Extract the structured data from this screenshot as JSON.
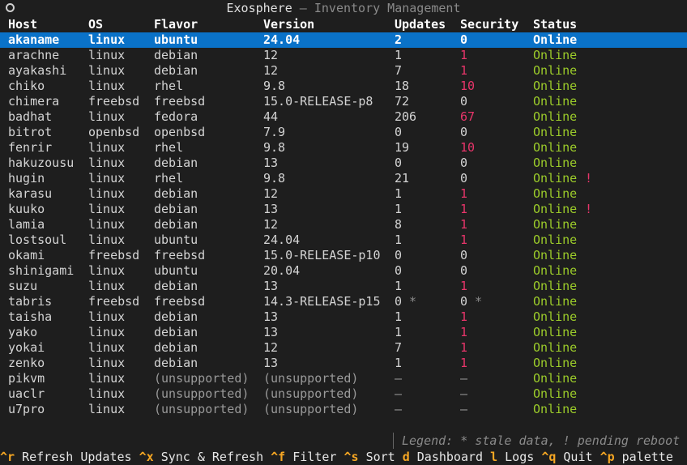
{
  "window": {
    "title": "Exosphere",
    "separator": " — ",
    "subtitle": "Inventory Management"
  },
  "columns": {
    "host": "Host",
    "os": "OS",
    "flavor": "Flavor",
    "version": "Version",
    "updates": "Updates",
    "security": "Security",
    "status": "Status"
  },
  "rows": [
    {
      "host": "akaname",
      "os": "linux",
      "flavor": "ubuntu",
      "version": "24.04",
      "updates": "2",
      "security": "0",
      "status": "Online",
      "selected": true
    },
    {
      "host": "arachne",
      "os": "linux",
      "flavor": "debian",
      "version": "12",
      "updates": "1",
      "security": "1",
      "status": "Online"
    },
    {
      "host": "ayakashi",
      "os": "linux",
      "flavor": "debian",
      "version": "12",
      "updates": "7",
      "security": "1",
      "status": "Online"
    },
    {
      "host": "chiko",
      "os": "linux",
      "flavor": "rhel",
      "version": "9.8",
      "updates": "18",
      "security": "10",
      "status": "Online"
    },
    {
      "host": "chimera",
      "os": "freebsd",
      "flavor": "freebsd",
      "version": "15.0-RELEASE-p8",
      "updates": "72",
      "security": "0",
      "status": "Online"
    },
    {
      "host": "badhat",
      "os": "linux",
      "flavor": "fedora",
      "version": "44",
      "updates": "206",
      "security": "67",
      "status": "Online"
    },
    {
      "host": "bitrot",
      "os": "openbsd",
      "flavor": "openbsd",
      "version": "7.9",
      "updates": "0",
      "security": "0",
      "status": "Online"
    },
    {
      "host": "fenrir",
      "os": "linux",
      "flavor": "rhel",
      "version": "9.8",
      "updates": "19",
      "security": "10",
      "status": "Online"
    },
    {
      "host": "hakuzousu",
      "os": "linux",
      "flavor": "debian",
      "version": "13",
      "updates": "0",
      "security": "0",
      "status": "Online"
    },
    {
      "host": "hugin",
      "os": "linux",
      "flavor": "rhel",
      "version": "9.8",
      "updates": "21",
      "security": "0",
      "status": "Online",
      "flag": "!"
    },
    {
      "host": "karasu",
      "os": "linux",
      "flavor": "debian",
      "version": "12",
      "updates": "1",
      "security": "1",
      "status": "Online"
    },
    {
      "host": "kuuko",
      "os": "linux",
      "flavor": "debian",
      "version": "13",
      "updates": "1",
      "security": "1",
      "status": "Online",
      "flag": "!"
    },
    {
      "host": "lamia",
      "os": "linux",
      "flavor": "debian",
      "version": "12",
      "updates": "8",
      "security": "1",
      "status": "Online"
    },
    {
      "host": "lostsoul",
      "os": "linux",
      "flavor": "ubuntu",
      "version": "24.04",
      "updates": "1",
      "security": "1",
      "status": "Online"
    },
    {
      "host": "okami",
      "os": "freebsd",
      "flavor": "freebsd",
      "version": "15.0-RELEASE-p10",
      "updates": "0",
      "security": "0",
      "status": "Online"
    },
    {
      "host": "shinigami",
      "os": "linux",
      "flavor": "ubuntu",
      "version": "20.04",
      "updates": "0",
      "security": "0",
      "status": "Online"
    },
    {
      "host": "suzu",
      "os": "linux",
      "flavor": "debian",
      "version": "13",
      "updates": "1",
      "security": "1",
      "status": "Online"
    },
    {
      "host": "tabris",
      "os": "freebsd",
      "flavor": "freebsd",
      "version": "14.3-RELEASE-p15",
      "updates": "0",
      "security": "0",
      "status": "Online",
      "stale": "*"
    },
    {
      "host": "taisha",
      "os": "linux",
      "flavor": "debian",
      "version": "13",
      "updates": "1",
      "security": "1",
      "status": "Online"
    },
    {
      "host": "yako",
      "os": "linux",
      "flavor": "debian",
      "version": "13",
      "updates": "1",
      "security": "1",
      "status": "Online"
    },
    {
      "host": "yokai",
      "os": "linux",
      "flavor": "debian",
      "version": "12",
      "updates": "7",
      "security": "1",
      "status": "Online"
    },
    {
      "host": "zenko",
      "os": "linux",
      "flavor": "debian",
      "version": "13",
      "updates": "1",
      "security": "1",
      "status": "Online"
    },
    {
      "host": "pikvm",
      "os": "linux",
      "flavor": "(unsupported)",
      "version": "(unsupported)",
      "updates": "–",
      "security": "–",
      "status": "Online"
    },
    {
      "host": "uaclr",
      "os": "linux",
      "flavor": "(unsupported)",
      "version": "(unsupported)",
      "updates": "–",
      "security": "–",
      "status": "Online"
    },
    {
      "host": "u7pro",
      "os": "linux",
      "flavor": "(unsupported)",
      "version": "(unsupported)",
      "updates": "–",
      "security": "–",
      "status": "Online"
    }
  ],
  "legend": "Legend: * stale data, ! pending reboot",
  "footer": [
    {
      "key": "^r",
      "label": "Refresh Updates"
    },
    {
      "key": "^x",
      "label": "Sync & Refresh"
    },
    {
      "key": "^f",
      "label": "Filter"
    },
    {
      "key": "^s",
      "label": "Sort"
    },
    {
      "key": "d",
      "label": "Dashboard"
    },
    {
      "key": "l",
      "label": "Logs"
    },
    {
      "key": "^q",
      "label": "Quit"
    },
    {
      "key": "^p",
      "label": "palette"
    }
  ],
  "colors": {
    "selected_bg": "#0a72c8",
    "online": "#9ccc2a",
    "security_red": "#e8356a",
    "key_orange": "#f5a623"
  }
}
